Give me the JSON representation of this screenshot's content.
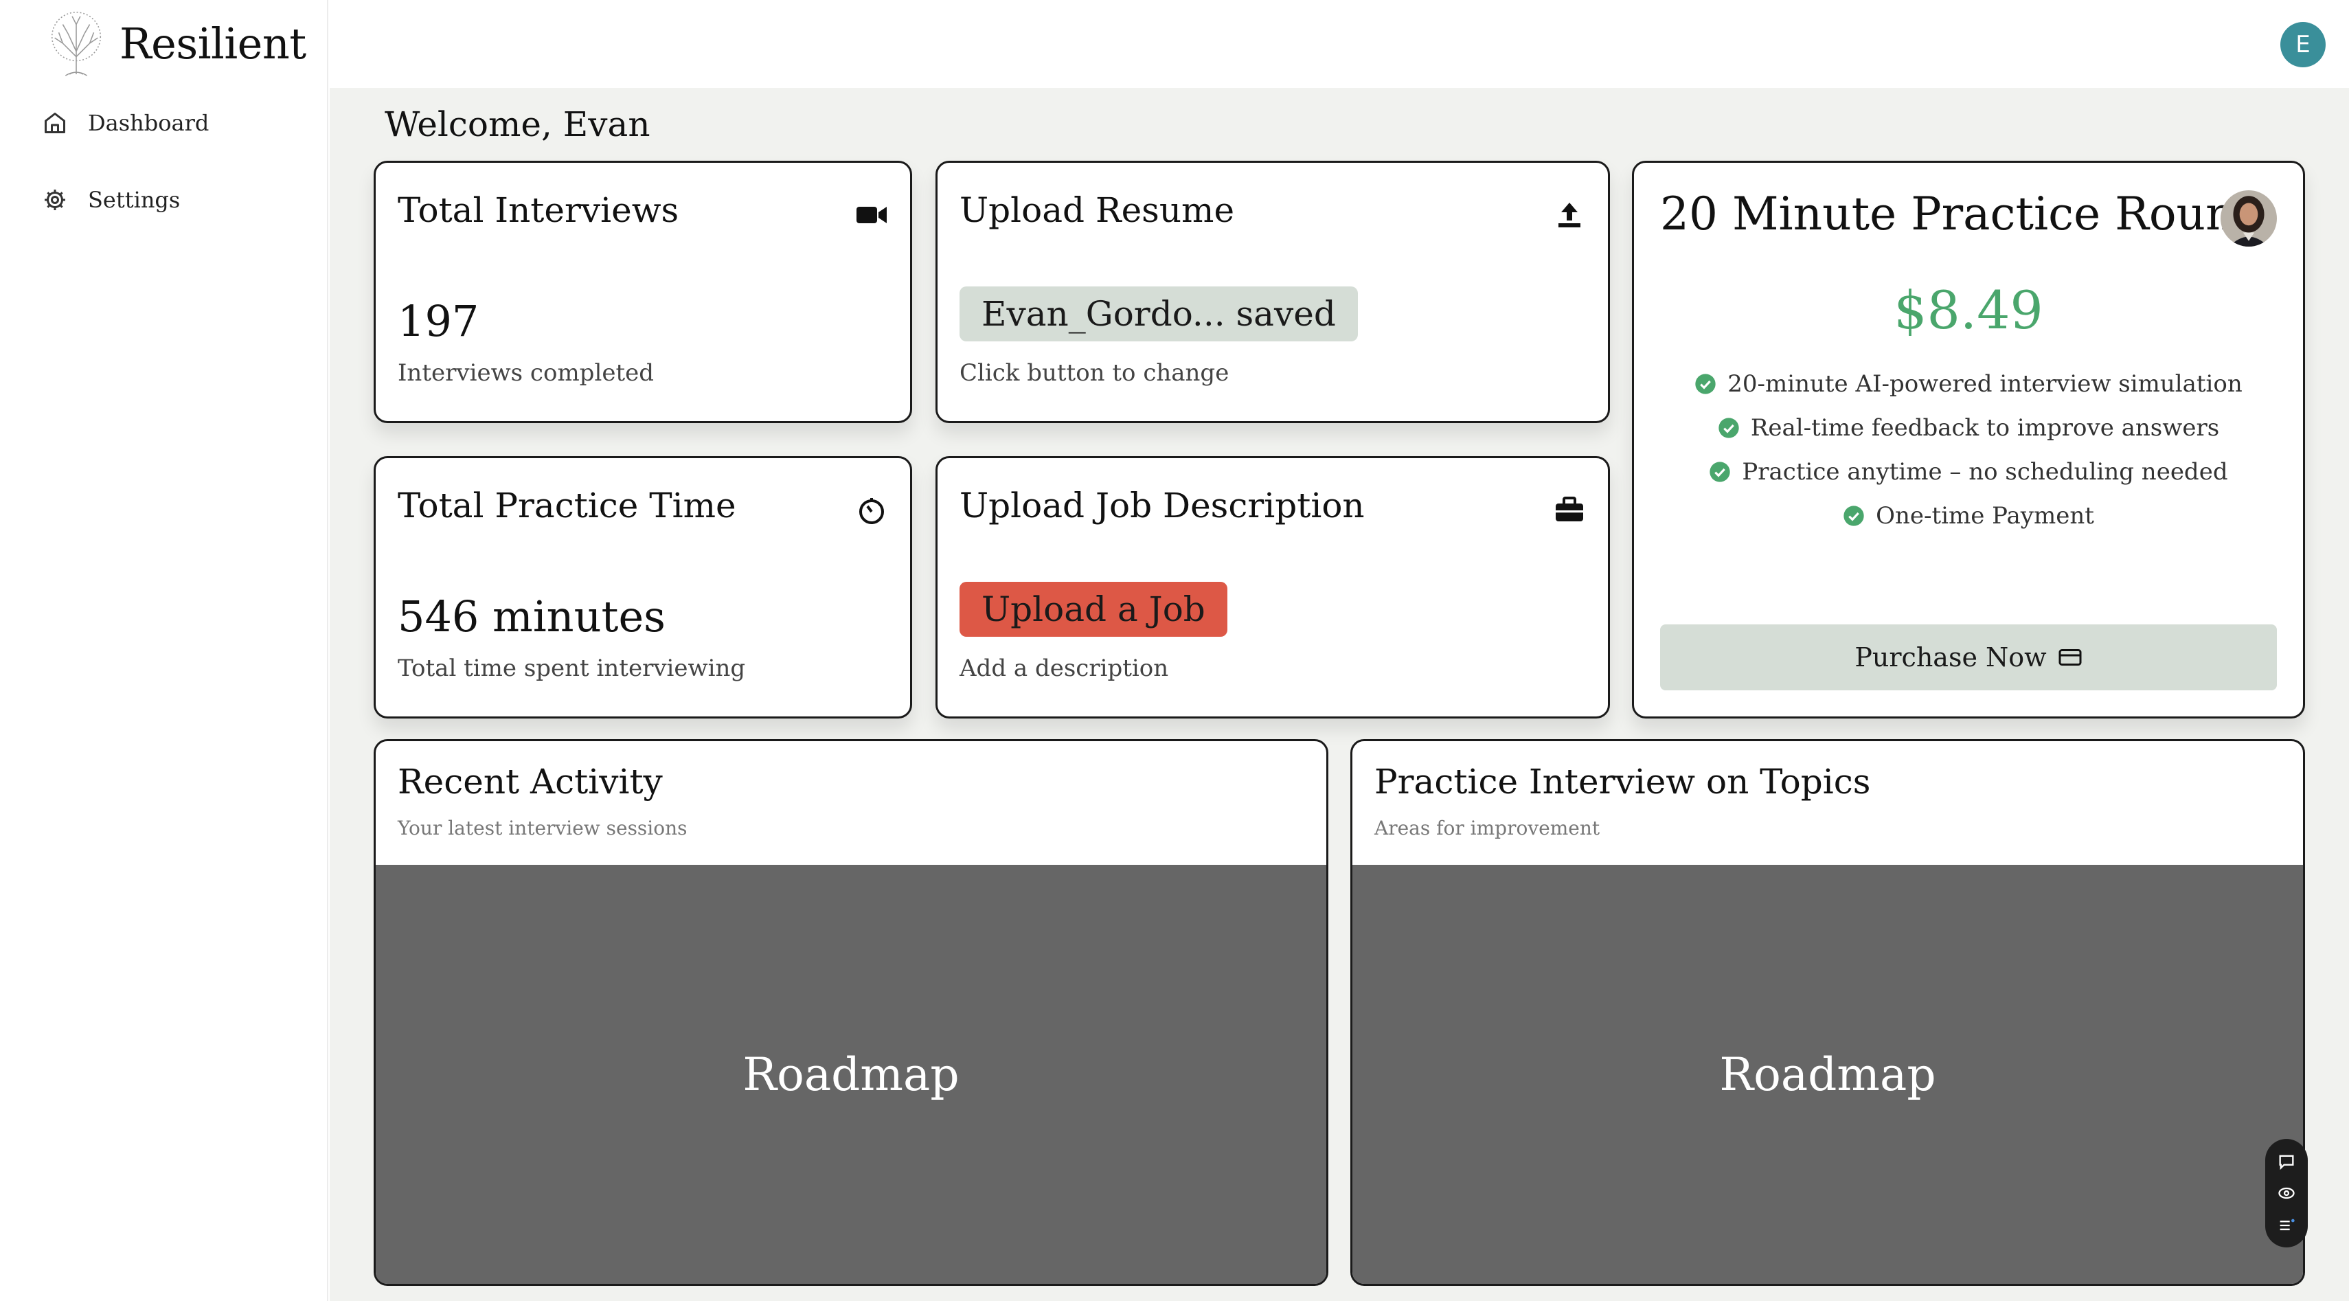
{
  "app": {
    "name": "Resilient"
  },
  "sidebar": {
    "items": [
      {
        "label": "Dashboard",
        "icon": "home-icon"
      },
      {
        "label": "Settings",
        "icon": "gear-icon"
      }
    ]
  },
  "user": {
    "initial": "E",
    "avatar_color": "#3a8f9a"
  },
  "welcome": "Welcome, Evan",
  "cards": {
    "total_interviews": {
      "title": "Total Interviews",
      "value": "197",
      "caption": "Interviews completed",
      "icon": "video-camera-icon"
    },
    "upload_resume": {
      "title": "Upload Resume",
      "status": "Evan_Gordo... saved",
      "caption": "Click button to change",
      "icon": "upload-icon"
    },
    "total_practice_time": {
      "title": "Total Practice Time",
      "value": "546 minutes",
      "caption": "Total time spent interviewing",
      "icon": "timer-icon"
    },
    "upload_job": {
      "title": "Upload Job Description",
      "button": "Upload a Job",
      "caption": "Add a description",
      "icon": "briefcase-icon"
    }
  },
  "pricing": {
    "title": "20 Minute Practice Round",
    "price": "$8.49",
    "features": [
      "20-minute AI-powered interview simulation",
      "Real-time feedback to improve answers",
      "Practice anytime – no scheduling needed",
      "One-time Payment"
    ],
    "button": "Purchase Now",
    "accent": "#4aa66c"
  },
  "panels": {
    "recent_activity": {
      "title": "Recent Activity",
      "subtitle": "Your latest interview sessions",
      "body": "Roadmap"
    },
    "practice_topics": {
      "title": "Practice Interview on Topics",
      "subtitle": "Areas for improvement",
      "body": "Roadmap"
    }
  },
  "colors": {
    "upload_job_button": "#dd5846",
    "saved_pill": "#d5ddd6",
    "panel_body": "#666666",
    "main_bg": "#f1f2ef"
  }
}
